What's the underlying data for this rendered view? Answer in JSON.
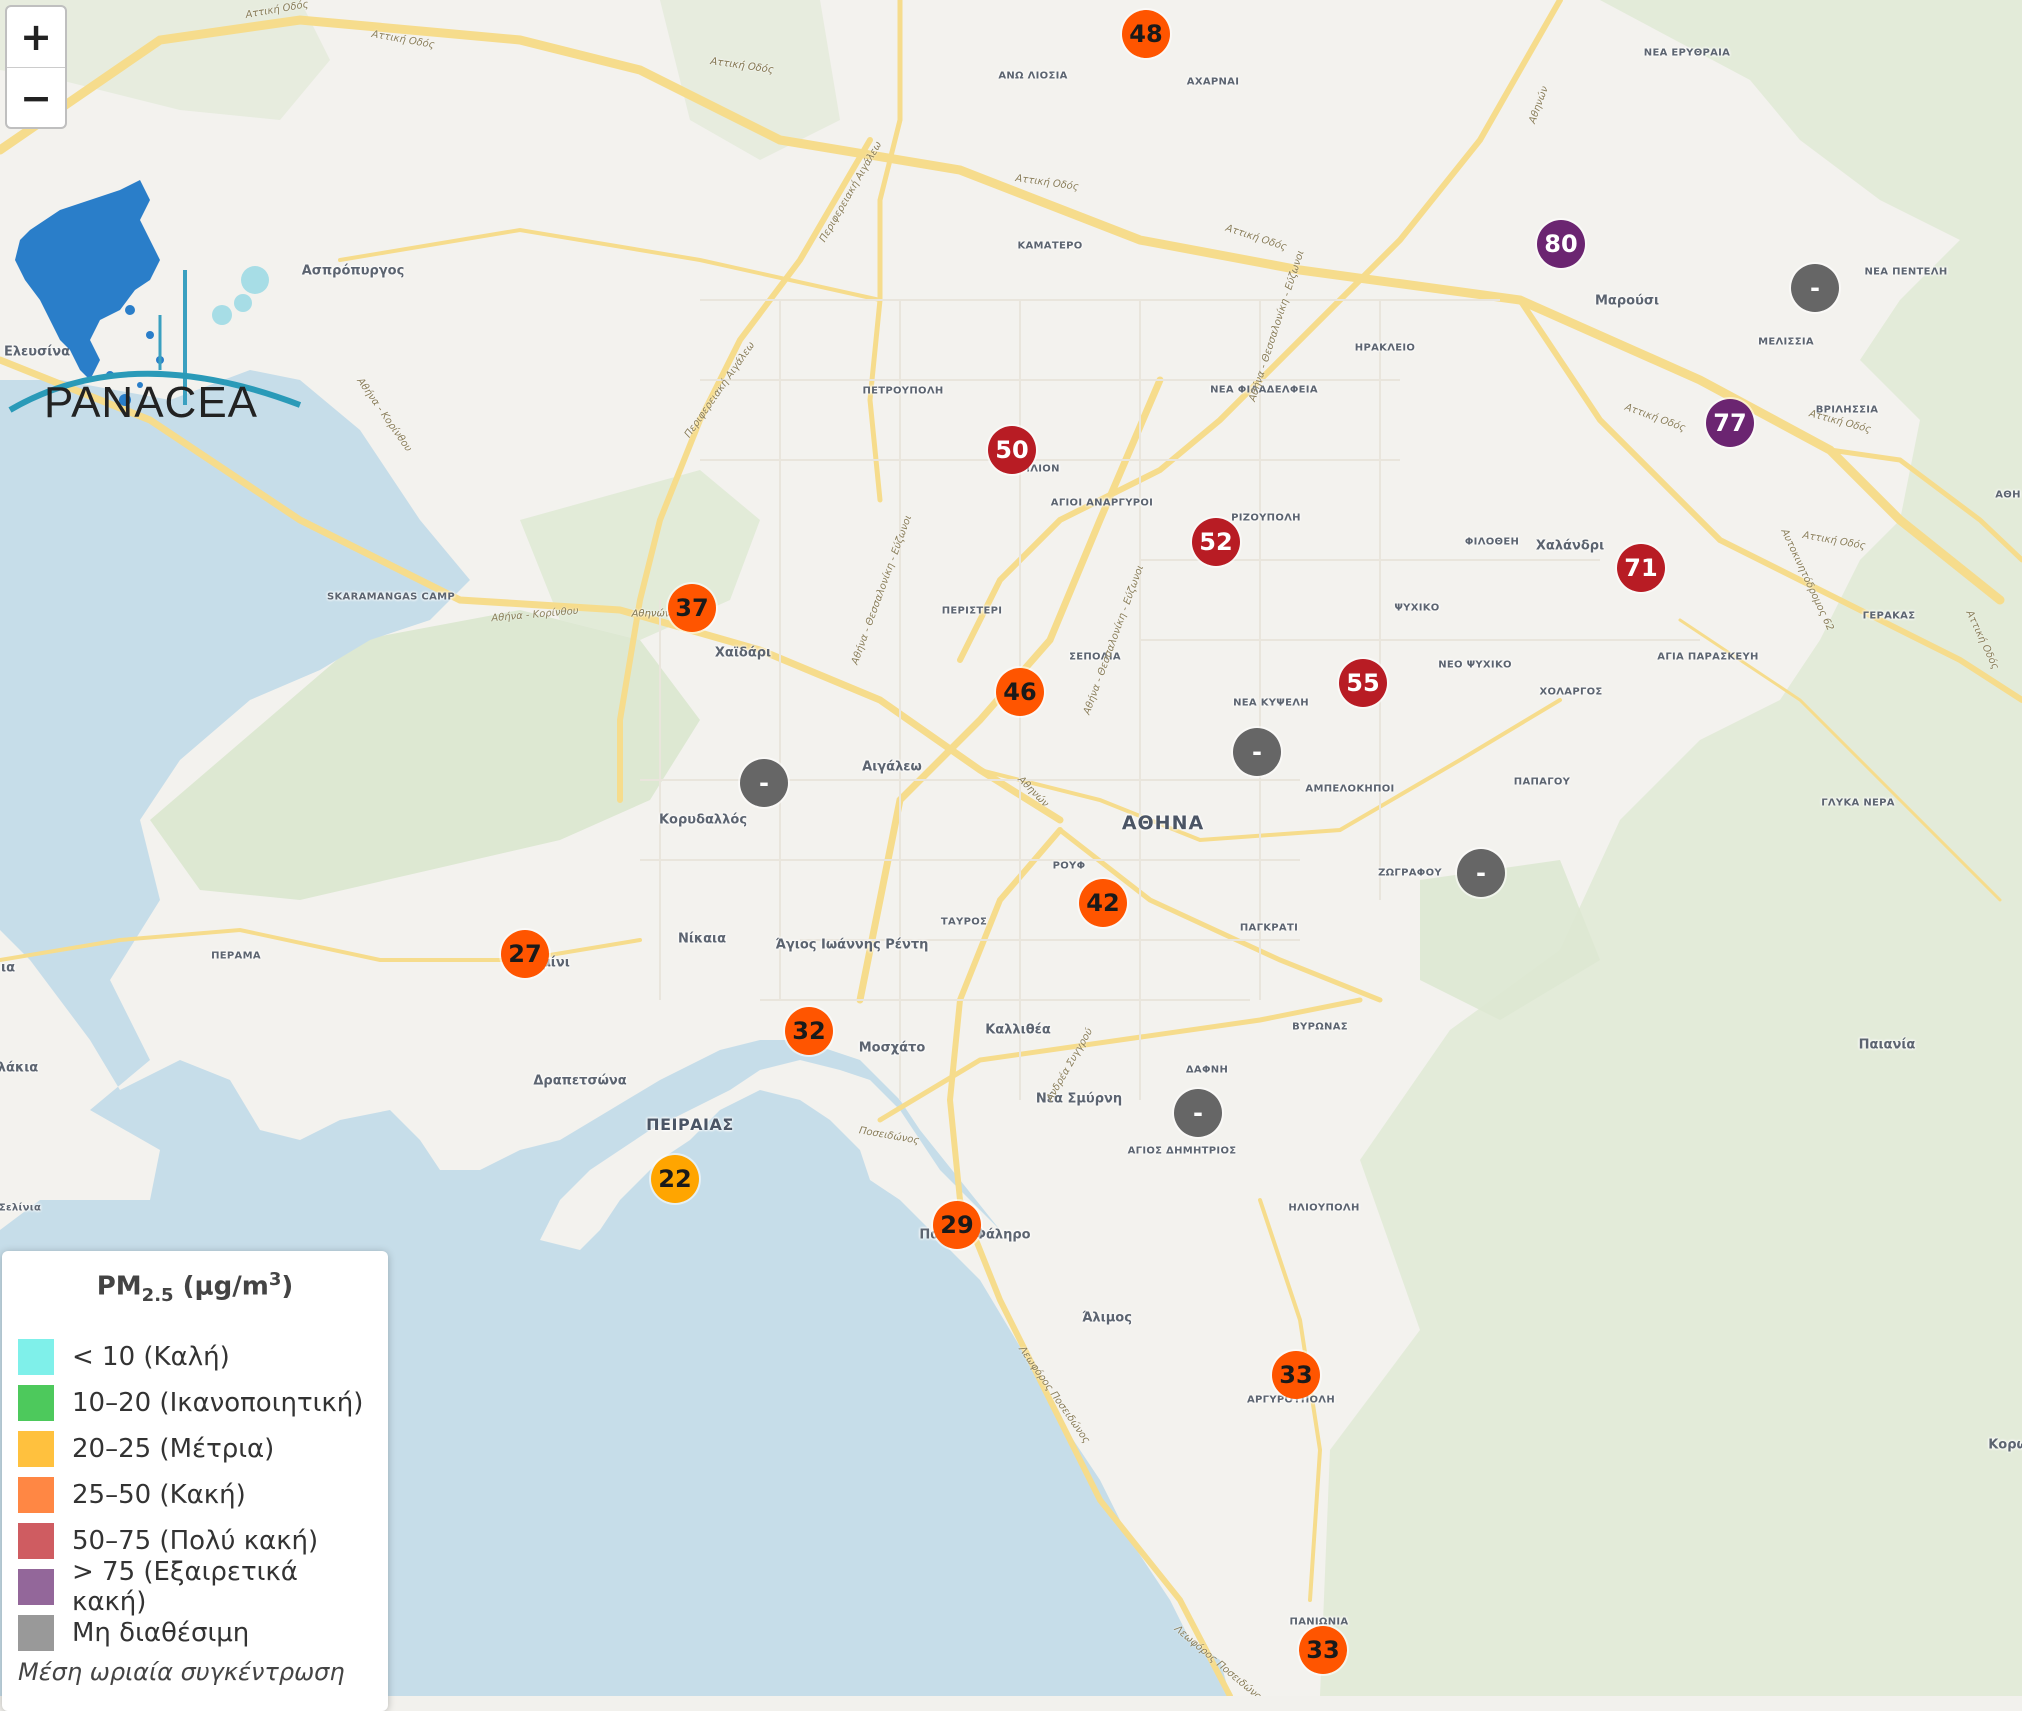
{
  "map": {
    "labels": [
      {
        "text": "ΑΝΩ ΛΙΟΣΙΑ",
        "kind": "small"
      },
      {
        "text": "ΑΧΑΡΝΑΙ",
        "kind": "small"
      },
      {
        "text": "ΝΕΑ ΕΡΥΘΡΑΙΑ",
        "kind": "small"
      },
      {
        "text": "ΚΑΜΑΤΕΡΟ",
        "kind": "small"
      },
      {
        "text": "Ασπρόπυργος",
        "kind": "mid"
      },
      {
        "text": "Ελευσίνα",
        "kind": "mid"
      },
      {
        "text": "ΠΕΤΡΟΥΠΟΛΗ",
        "kind": "small"
      },
      {
        "text": "ΝΕΑ ΦΙΛΑΔΕΛΦΕΙΑ",
        "kind": "small"
      },
      {
        "text": "ΗΡΑΚΛΕΙΟ",
        "kind": "small"
      },
      {
        "text": "Μαρούσι",
        "kind": "mid"
      },
      {
        "text": "ΜΕΛΙΣΣΙΑ",
        "kind": "small"
      },
      {
        "text": "ΝΕΑ ΠΕΝΤΕΛΗ",
        "kind": "small"
      },
      {
        "text": "ΒΡΙΛΗΣΣΙΑ",
        "kind": "small"
      },
      {
        "text": "ΙΛΙΟΝ",
        "kind": "small"
      },
      {
        "text": "ΑΓΙΟΙ ΑΝΑΡΓΥΡΟΙ",
        "kind": "small"
      },
      {
        "text": "ΡΙΖΟΥΠΟΛΗ",
        "kind": "small"
      },
      {
        "text": "ΦΙΛΟΘΕΗ",
        "kind": "small"
      },
      {
        "text": "Χαλάνδρι",
        "kind": "mid"
      },
      {
        "text": "SKARAMANGAS CAMP",
        "kind": "small"
      },
      {
        "text": "Χαϊδάρι",
        "kind": "mid"
      },
      {
        "text": "ΠΕΡΙΣΤΕΡΙ",
        "kind": "small"
      },
      {
        "text": "ΣΕΠΟΛΙΑ",
        "kind": "small"
      },
      {
        "text": "ΨΥΧΙΚΟ",
        "kind": "small"
      },
      {
        "text": "ΝΕΟ ΨΥΧΙΚΟ",
        "kind": "small"
      },
      {
        "text": "ΑΓΙΑ ΠΑΡΑΣΚΕΥΗ",
        "kind": "small"
      },
      {
        "text": "ΓΕΡΑΚΑΣ",
        "kind": "small"
      },
      {
        "text": "ΝΕΑ ΚΥΨΕΛΗ",
        "kind": "small"
      },
      {
        "text": "ΧΟΛΑΡΓΟΣ",
        "kind": "small"
      },
      {
        "text": "Αιγάλεω",
        "kind": "mid"
      },
      {
        "text": "Κορυδαλλός",
        "kind": "mid"
      },
      {
        "text": "ΑΜΠΕΛΟΚΗΠΟΙ",
        "kind": "small"
      },
      {
        "text": "ΠΑΠΑΓΟΥ",
        "kind": "small"
      },
      {
        "text": "ΓΛΥΚΑ ΝΕΡΑ",
        "kind": "small"
      },
      {
        "text": "ΑΘΗΝΑ",
        "kind": "city"
      },
      {
        "text": "ΡΟΥΦ",
        "kind": "small"
      },
      {
        "text": "ΖΩΓΡΑΦΟΥ",
        "kind": "small"
      },
      {
        "text": "ΠΕΡΑΜΑ",
        "kind": "small"
      },
      {
        "text": "Νίκαια",
        "kind": "mid"
      },
      {
        "text": "Άγιος Ιωάννης Ρέντη",
        "kind": "mid"
      },
      {
        "text": "ΤΑΥΡΟΣ",
        "kind": "small"
      },
      {
        "text": "ΠΑΓΚΡΑΤΙ",
        "kind": "small"
      },
      {
        "text": "Καλλιθέα",
        "kind": "mid"
      },
      {
        "text": "ΒΥΡΩΝΑΣ",
        "kind": "small"
      },
      {
        "text": "Μοσχάτο",
        "kind": "mid"
      },
      {
        "text": "Παιανία",
        "kind": "mid"
      },
      {
        "text": "Δραπετσώνα",
        "kind": "mid"
      },
      {
        "text": "ΔΑΦΝΗ",
        "kind": "small"
      },
      {
        "text": "ΠΕΙΡΑΙΑΣ",
        "kind": "port"
      },
      {
        "text": "Νέα Σμύρνη",
        "kind": "mid"
      },
      {
        "text": "ΑΓΙΟΣ ΔΗΜΗΤΡΙΟΣ",
        "kind": "small"
      },
      {
        "text": "ΗΛΙΟΥΠΟΛΗ",
        "kind": "small"
      },
      {
        "text": "Άλιμος",
        "kind": "mid"
      },
      {
        "text": "ΑΡΓΥΡΟΥΠΟΛΗ",
        "kind": "small"
      },
      {
        "text": "ΠΑΝΙΩΝΙΑ",
        "kind": "small"
      },
      {
        "text": "ΑΘΗ",
        "kind": "small"
      },
      {
        "text": "Κορω",
        "kind": "mid"
      },
      {
        "text": "ια",
        "kind": "mid"
      },
      {
        "text": "λάκια",
        "kind": "mid"
      },
      {
        "text": "Σελίνια",
        "kind": "small"
      },
      {
        "text": "Σαλαμίνι",
        "kind": "mid"
      },
      {
        "text": "Παλαιό Φάληρο",
        "kind": "mid"
      }
    ],
    "roads": [
      {
        "text": "Αττική Οδός"
      },
      {
        "text": "Αττική Οδός"
      },
      {
        "text": "Αττική Οδός"
      },
      {
        "text": "Αττική Οδός"
      },
      {
        "text": "Αττική Οδός"
      },
      {
        "text": "Αττική Οδός"
      },
      {
        "text": "Αθήνα - Κορίνθου"
      },
      {
        "text": "Αθηνών"
      },
      {
        "text": "Αθήνα - Θεσσαλονίκη - Εύζωνοι"
      },
      {
        "text": "Περιφερειακή Αιγάλεω"
      },
      {
        "text": "Ποσειδώνος"
      },
      {
        "text": "Λεωφόρος Ποσειδώνος"
      },
      {
        "text": "Ανδρέα Συγγρού"
      },
      {
        "text": "Αττική Οδός"
      },
      {
        "text": "Αττική Οδός"
      },
      {
        "text": "Αθήνα - Κορίνθου"
      },
      {
        "text": "Αθηνών"
      },
      {
        "text": "Αθήνα - Θεσσαλονίκη - Εύζωνοι"
      },
      {
        "text": "Αθήνα - Θεσσαλονίκη - Εύζωνοι"
      },
      {
        "text": "Περιφερειακή Αιγάλεω"
      },
      {
        "text": "Αθηνών"
      },
      {
        "text": "Αθηνών"
      },
      {
        "text": "Αυτοκινητόδρομος 62"
      },
      {
        "text": "Αττική Οδός"
      },
      {
        "text": "Αττική Οδός"
      },
      {
        "text": "Λεωφόρος Ποσειδώνος"
      }
    ],
    "stations": [
      {
        "value": "48",
        "color": "#ff5500"
      },
      {
        "value": "80",
        "color": "#6b2571"
      },
      {
        "value": "-",
        "color": "#666666"
      },
      {
        "value": "77",
        "color": "#6b2571"
      },
      {
        "value": "50",
        "color": "#b81c24"
      },
      {
        "value": "52",
        "color": "#b81c24"
      },
      {
        "value": "71",
        "color": "#b81c24"
      },
      {
        "value": "37",
        "color": "#ff5500"
      },
      {
        "value": "46",
        "color": "#ff5500"
      },
      {
        "value": "55",
        "color": "#b81c24"
      },
      {
        "value": "-",
        "color": "#666666"
      },
      {
        "value": "-",
        "color": "#666666"
      },
      {
        "value": "-",
        "color": "#666666"
      },
      {
        "value": "42",
        "color": "#ff5500"
      },
      {
        "value": "27",
        "color": "#ff5500"
      },
      {
        "value": "32",
        "color": "#ff5500"
      },
      {
        "value": "-",
        "color": "#666666"
      },
      {
        "value": "22",
        "color": "#ffa500"
      },
      {
        "value": "29",
        "color": "#ff5500"
      },
      {
        "value": "33",
        "color": "#ff5500"
      },
      {
        "value": "33",
        "color": "#ff5500"
      }
    ]
  },
  "controls": {
    "zoom_in": "+",
    "zoom_out": "−"
  },
  "logo": {
    "name": "PANACEA"
  },
  "legend": {
    "title_main": "PM",
    "title_sub": "2.5",
    "title_unit_pre": " (μg/m",
    "title_unit_sup": "3",
    "title_unit_post": ")",
    "items": [
      {
        "label": "< 10 (Καλή)",
        "color": "#7ff0ea"
      },
      {
        "label": "10–20 (Ικανοποιητική)",
        "color": "#4dc95c"
      },
      {
        "label": "20–25 (Μέτρια)",
        "color": "#ffc13e"
      },
      {
        "label": "25–50 (Κακή)",
        "color": "#ff8744"
      },
      {
        "label": "50–75 (Πολύ κακή)",
        "color": "#cf5c61"
      },
      {
        "label": "> 75 (Εξαιρετικά κακή)",
        "color": "#93679a"
      },
      {
        "label": "Μη διαθέσιμη",
        "color": "#999999"
      }
    ],
    "note": "Μέση ωριαία συγκέντρωση"
  }
}
